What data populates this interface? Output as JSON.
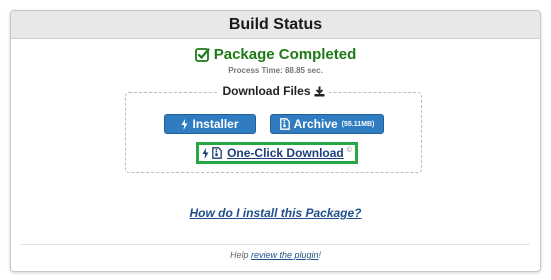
{
  "panel": {
    "title": "Build Status"
  },
  "status": {
    "icon": "check-square-icon",
    "text": "Package Completed",
    "process_time": "Process Time: 88.85 sec.",
    "color": "#1e7a16"
  },
  "downloads": {
    "title": "Download Files",
    "title_icon": "download-icon",
    "installer_label": "Installer",
    "installer_icon": "bolt-icon",
    "archive_label": "Archive",
    "archive_icon": "file-archive-icon",
    "archive_size": "(55.11MB)",
    "one_click_label": "One-Click Download",
    "one_click_icons": [
      "bolt-icon",
      "file-archive-icon"
    ],
    "one_click_suffix_icon": "copyright-icon",
    "button_color": "#2f7cc1",
    "highlight_color": "#28a745"
  },
  "help": {
    "install_link": "How do I install this Package?",
    "footer_prefix": "Help ",
    "footer_link": "review the plugin",
    "footer_suffix": "!"
  }
}
